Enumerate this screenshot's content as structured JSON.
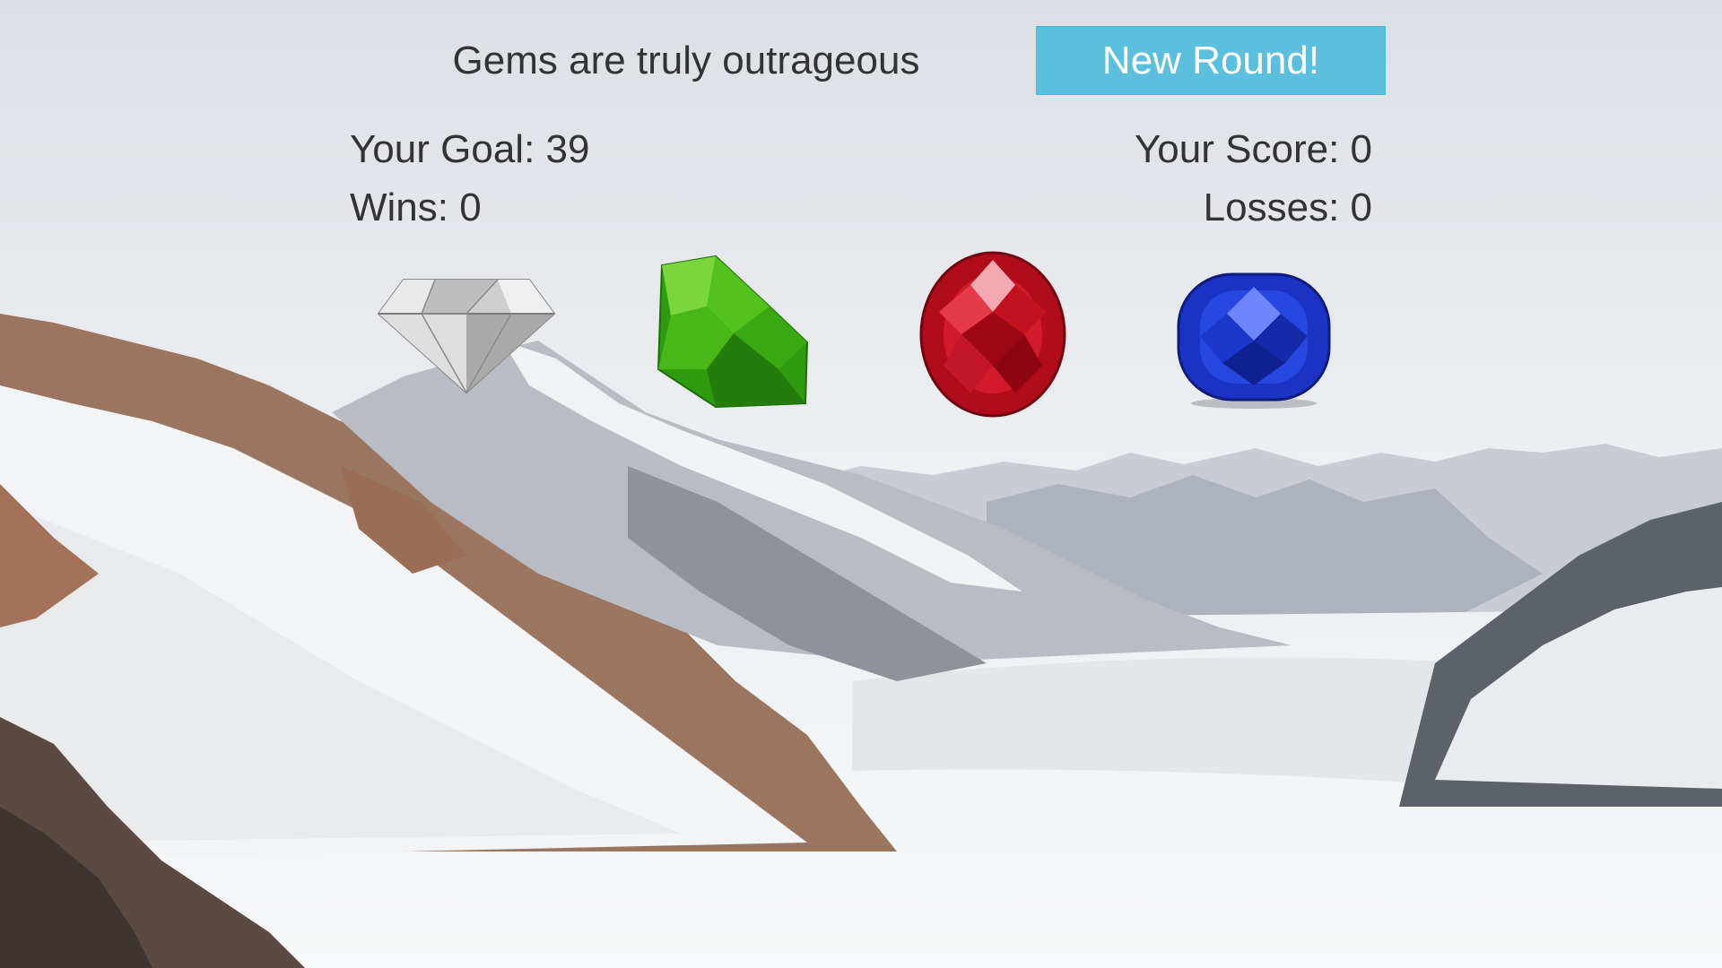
{
  "header": {
    "title": "Gems are truly outrageous",
    "new_round_label": "New Round!",
    "accent_color": "#5bc0de"
  },
  "stats": {
    "goal": "Your Goal: 39",
    "score": "Your Score: 0",
    "wins": "Wins: 0",
    "losses": "Losses: 0"
  },
  "gems": [
    {
      "name": "diamond",
      "color": "#d9d9d9"
    },
    {
      "name": "emerald",
      "color": "#3fb21a"
    },
    {
      "name": "ruby",
      "color": "#c0101e"
    },
    {
      "name": "sapphire",
      "color": "#1c36c8"
    }
  ],
  "background": {
    "scene": "snowy-mountain-landscape",
    "sky_color": "#e6e9ee"
  }
}
